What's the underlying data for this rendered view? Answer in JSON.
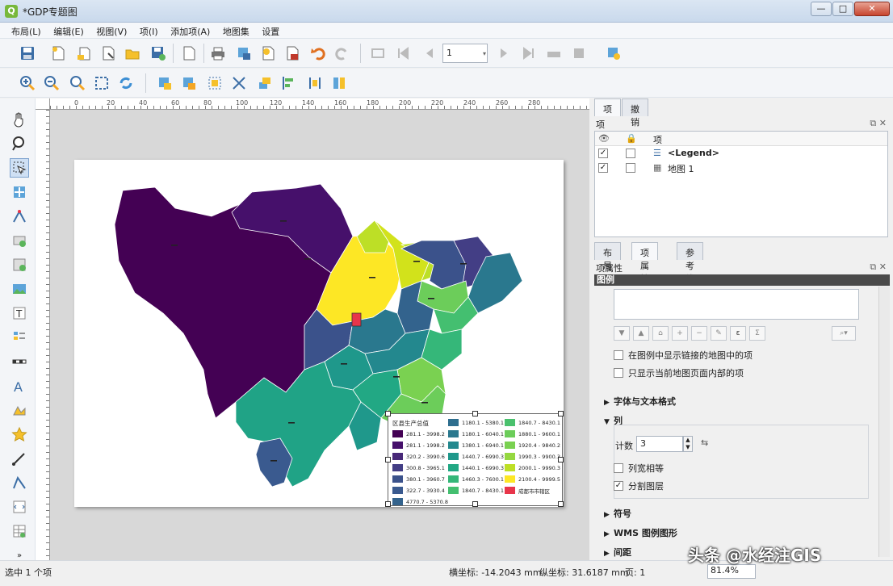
{
  "window": {
    "title": "*GDP专题图",
    "minimize": "—",
    "maximize": "□",
    "close": "✕"
  },
  "menu": [
    "布局(L)",
    "编辑(E)",
    "视图(V)",
    "项(I)",
    "添加项(A)",
    "地图集",
    "设置"
  ],
  "toolbar": {
    "page_number": "1"
  },
  "ruler": {
    "ticks": [
      "0",
      "20",
      "40",
      "60",
      "80",
      "100",
      "120",
      "140",
      "160",
      "180",
      "200",
      "220",
      "240",
      "260",
      "280"
    ]
  },
  "map": {
    "labels": [
      "—",
      "—",
      "—",
      "—",
      "—",
      "—",
      "—",
      "—",
      "—",
      "—",
      "—",
      "—"
    ]
  },
  "legend": {
    "title": "区县生产总值",
    "columns": [
      [
        {
          "label": "281.1 - 3998.2",
          "color": "#440154"
        },
        {
          "label": "281.1 - 1998.2",
          "color": "#46106b"
        },
        {
          "label": "320.2 - 3990.6",
          "color": "#482878"
        },
        {
          "label": "300.8 - 3965.1",
          "color": "#433e85"
        },
        {
          "label": "380.1 - 3960.7",
          "color": "#3b528b"
        },
        {
          "label": "322.7 - 3930.4",
          "color": "#3a5a8f"
        },
        {
          "label": "4770.7 - 5370.8",
          "color": "#33638d"
        }
      ],
      [
        {
          "label": "1180.1 - 5380.1",
          "color": "#2e6e8e"
        },
        {
          "label": "1180.1 - 6040.1",
          "color": "#2a788e"
        },
        {
          "label": "1380.1 - 6940.1",
          "color": "#23888e"
        },
        {
          "label": "1440.7 - 6990.3",
          "color": "#1f988b"
        },
        {
          "label": "1440.1 - 6990.3",
          "color": "#22a884"
        },
        {
          "label": "1460.3 - 7600.1",
          "color": "#35b779"
        },
        {
          "label": "1840.7 - 8430.1",
          "color": "#44bf70"
        }
      ],
      [
        {
          "label": "1840.7 - 8430.1",
          "color": "#4ac16d"
        },
        {
          "label": "1880.1 - 9600.1",
          "color": "#6ccd5a"
        },
        {
          "label": "1920.4 - 9840.2",
          "color": "#7ad151"
        },
        {
          "label": "1990.3 - 9900.3",
          "color": "#95d840"
        },
        {
          "label": "2000.1 - 9990.3",
          "color": "#bddf26"
        },
        {
          "label": "2100.4 - 9999.5",
          "color": "#fde725"
        },
        {
          "label": "成都市市辖区",
          "color": "#e8354a"
        }
      ]
    ]
  },
  "right": {
    "top_tabs": [
      "项",
      "撤销历史"
    ],
    "items_header": "项",
    "items_cols": [
      "",
      "",
      "项"
    ],
    "items": [
      {
        "name": "<Legend>",
        "checked": true
      },
      {
        "name": "地图 1",
        "checked": true
      }
    ],
    "bottom_tabs": [
      "布局",
      "项属性",
      "参考线"
    ],
    "props_header": "项属性",
    "props_group": "图例",
    "opt1": "在图例中显示链接的地图中的项",
    "opt2": "只显示当前地图页面内部的项",
    "section_fonts": "字体与文本格式",
    "section_columns": "列",
    "count_label": "计数",
    "count_value": "3",
    "opt_equal": "列宽相等",
    "opt_split": "分割图层",
    "section_symbol": "符号",
    "section_wms": "WMS 图例图形",
    "section_spacing": "间距"
  },
  "status": {
    "left": "选中 1 个项",
    "x_label": "横坐标: -14.2043 mm",
    "y_label": "纵坐标: 31.6187 mm",
    "page": "页: 1",
    "zoom": "81.4%"
  },
  "watermark": "头条 @水经注GIS"
}
